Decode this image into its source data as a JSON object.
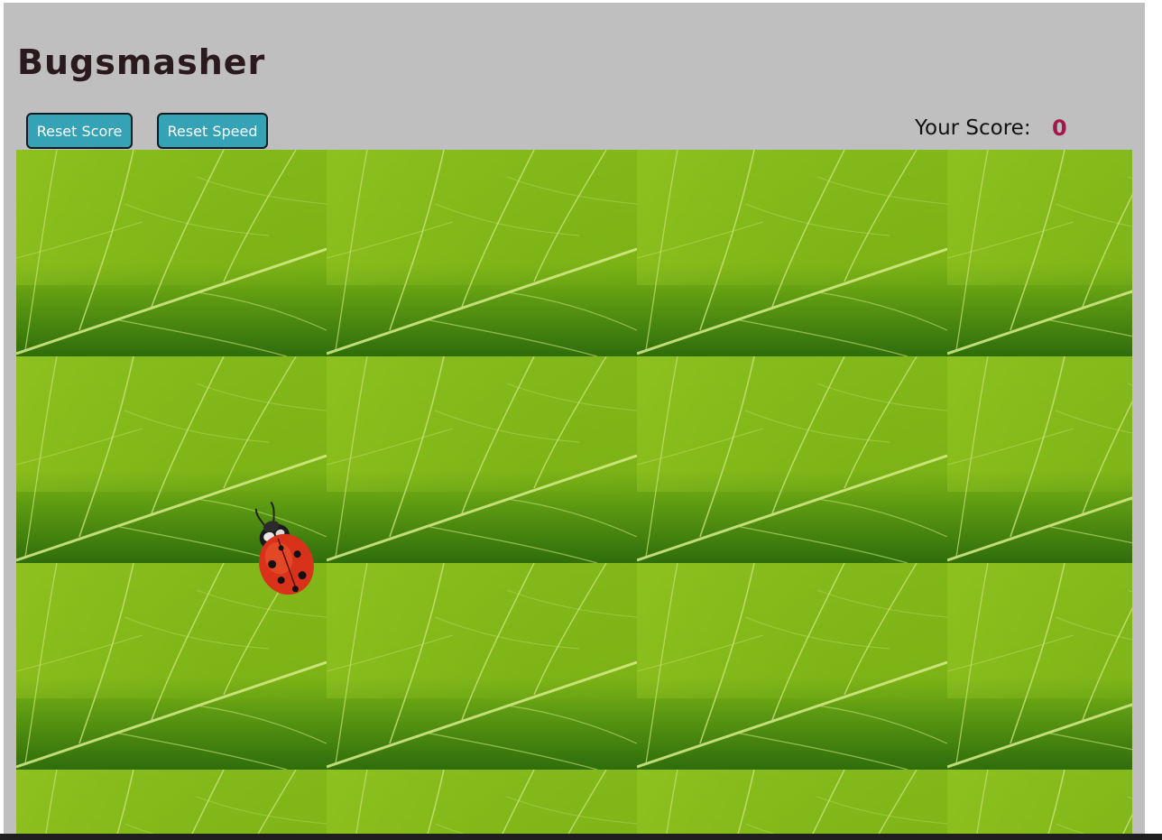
{
  "game": {
    "title": "Bugsmasher",
    "buttons": {
      "reset_score": "Reset Score",
      "reset_speed": "Reset Speed"
    },
    "score": {
      "label": "Your Score:",
      "value": "0"
    },
    "board": {
      "background": "leaf-texture",
      "bug": "ladybug-icon"
    }
  },
  "colors": {
    "page_bg": "#bfbfbf",
    "button_bg": "#35a2b6",
    "score_value": "#a3174a",
    "leaf_light": "#8fc21f",
    "leaf_dark": "#2f6d0c"
  }
}
